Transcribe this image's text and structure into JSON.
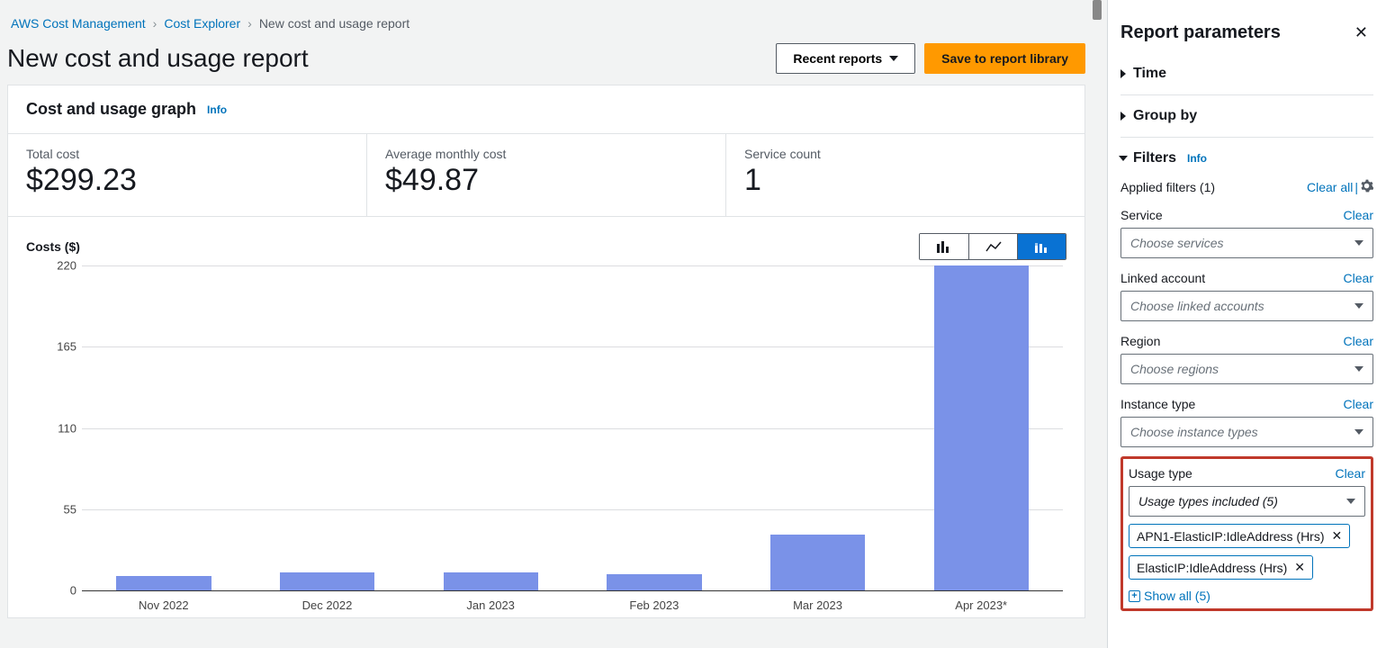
{
  "breadcrumb": {
    "root": "AWS Cost Management",
    "section": "Cost Explorer",
    "current": "New cost and usage report"
  },
  "page": {
    "title": "New cost and usage report",
    "recent_reports": "Recent reports",
    "save_btn": "Save to report library"
  },
  "card": {
    "heading": "Cost and usage graph",
    "info": "Info"
  },
  "metrics": {
    "total_label": "Total cost",
    "total_value": "$299.23",
    "avg_label": "Average monthly cost",
    "avg_value": "$49.87",
    "svc_label": "Service count",
    "svc_value": "1"
  },
  "chart": {
    "y_title": "Costs ($)"
  },
  "chart_data": {
    "type": "bar",
    "categories": [
      "Nov 2022",
      "Dec 2022",
      "Jan 2023",
      "Feb 2023",
      "Mar 2023",
      "Apr 2023*"
    ],
    "values": [
      10,
      12,
      12,
      11,
      38,
      220
    ],
    "title": "Costs ($)",
    "xlabel": "",
    "ylabel": "Costs ($)",
    "ylim": [
      0,
      220
    ],
    "y_ticks": [
      0,
      55,
      110,
      165,
      220
    ]
  },
  "sidepanel": {
    "title": "Report parameters",
    "sections": {
      "time": "Time",
      "group_by": "Group by",
      "filters": "Filters",
      "filters_info": "Info"
    },
    "applied": {
      "label": "Applied filters (1)",
      "clear_all": "Clear all"
    },
    "filters": {
      "service": {
        "label": "Service",
        "clear": "Clear",
        "placeholder": "Choose services"
      },
      "linked": {
        "label": "Linked account",
        "clear": "Clear",
        "placeholder": "Choose linked accounts"
      },
      "region": {
        "label": "Region",
        "clear": "Clear",
        "placeholder": "Choose regions"
      },
      "instance": {
        "label": "Instance type",
        "clear": "Clear",
        "placeholder": "Choose instance types"
      },
      "usage": {
        "label": "Usage type",
        "clear": "Clear",
        "value": "Usage types included (5)",
        "tags": [
          "APN1-ElasticIP:IdleAddress (Hrs)",
          "ElasticIP:IdleAddress (Hrs)"
        ],
        "show_all": "Show all (5)"
      }
    }
  }
}
